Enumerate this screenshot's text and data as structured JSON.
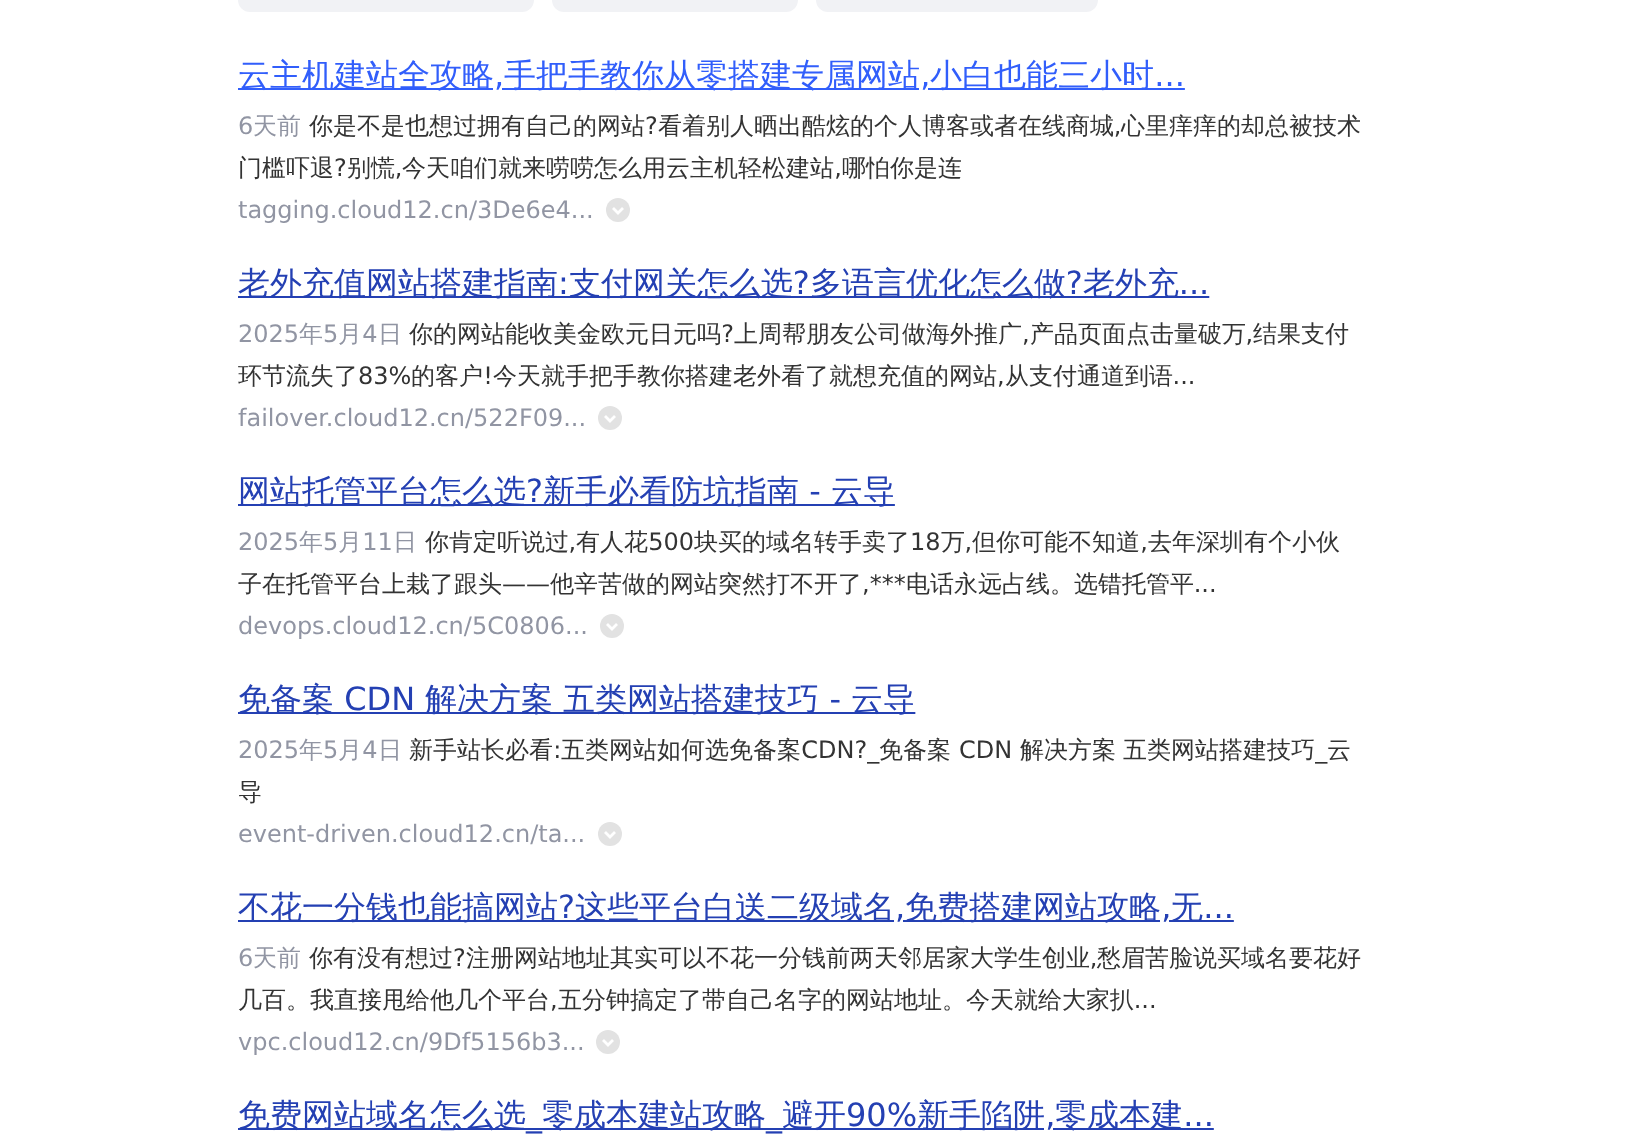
{
  "top_chips": [
    {
      "kind": "chip"
    },
    {
      "kind": "chip"
    },
    {
      "kind": "chip"
    }
  ],
  "results": [
    {
      "title": "云主机建站全攻略,手把手教你从零搭建专属网站,小白也能三小时...",
      "hovered": true,
      "date": "6天前",
      "snippet": "你是不是也想过拥有自己的网站?看着别人晒出酷炫的个人博客或者在线商城,心里痒痒的却总被技术门槛吓退?别慌,今天咱们就来唠唠怎么用云主机轻松建站,哪怕你是连",
      "url": "tagging.cloud12.cn/3De6e4..."
    },
    {
      "title": "老外充值网站搭建指南:支付网关怎么选?多语言优化怎么做?老外充...",
      "hovered": false,
      "date": "2025年5月4日",
      "snippet": "你的网站能收美金欧元日元吗?上周帮朋友公司做海外推广,产品页面点击量破万,结果支付环节流失了83%的客户!今天就手把手教你搭建老外看了就想充值的网站,从支付通道到语...",
      "url": "failover.cloud12.cn/522F09..."
    },
    {
      "title": "网站托管平台怎么选?新手必看防坑指南 - 云导",
      "hovered": false,
      "date": "2025年5月11日",
      "snippet": "你肯定听说过,有人花500块买的域名转手卖了18万,但你可能不知道,去年深圳有个小伙子在托管平台上栽了跟头——他辛苦做的网站突然打不开了,***电话永远占线。选错托管平...",
      "url": "devops.cloud12.cn/5C0806..."
    },
    {
      "title": "免备案 CDN 解决方案 五类网站搭建技巧 - 云导",
      "hovered": false,
      "date": "2025年5月4日",
      "snippet": "新手站长必看:五类网站如何选免备案CDN?_免备案 CDN 解决方案 五类网站搭建技巧_云导",
      "url": "event-driven.cloud12.cn/ta..."
    },
    {
      "title": "不花一分钱也能搞网站?这些平台白送二级域名,免费搭建网站攻略,无...",
      "hovered": false,
      "date": "6天前",
      "snippet": "你有没有想过?注册网站地址其实可以不花一分钱前两天邻居家大学生创业,愁眉苦脸说买域名要花好几百。我直接甩给他几个平台,五分钟搞定了带自己名字的网站地址。今天就给大家扒...",
      "url": "vpc.cloud12.cn/9Df5156b3..."
    },
    {
      "title": "免费网站域名怎么选_零成本建站攻略_避开90%新手陷阱,零成本建...",
      "hovered": false
    }
  ]
}
